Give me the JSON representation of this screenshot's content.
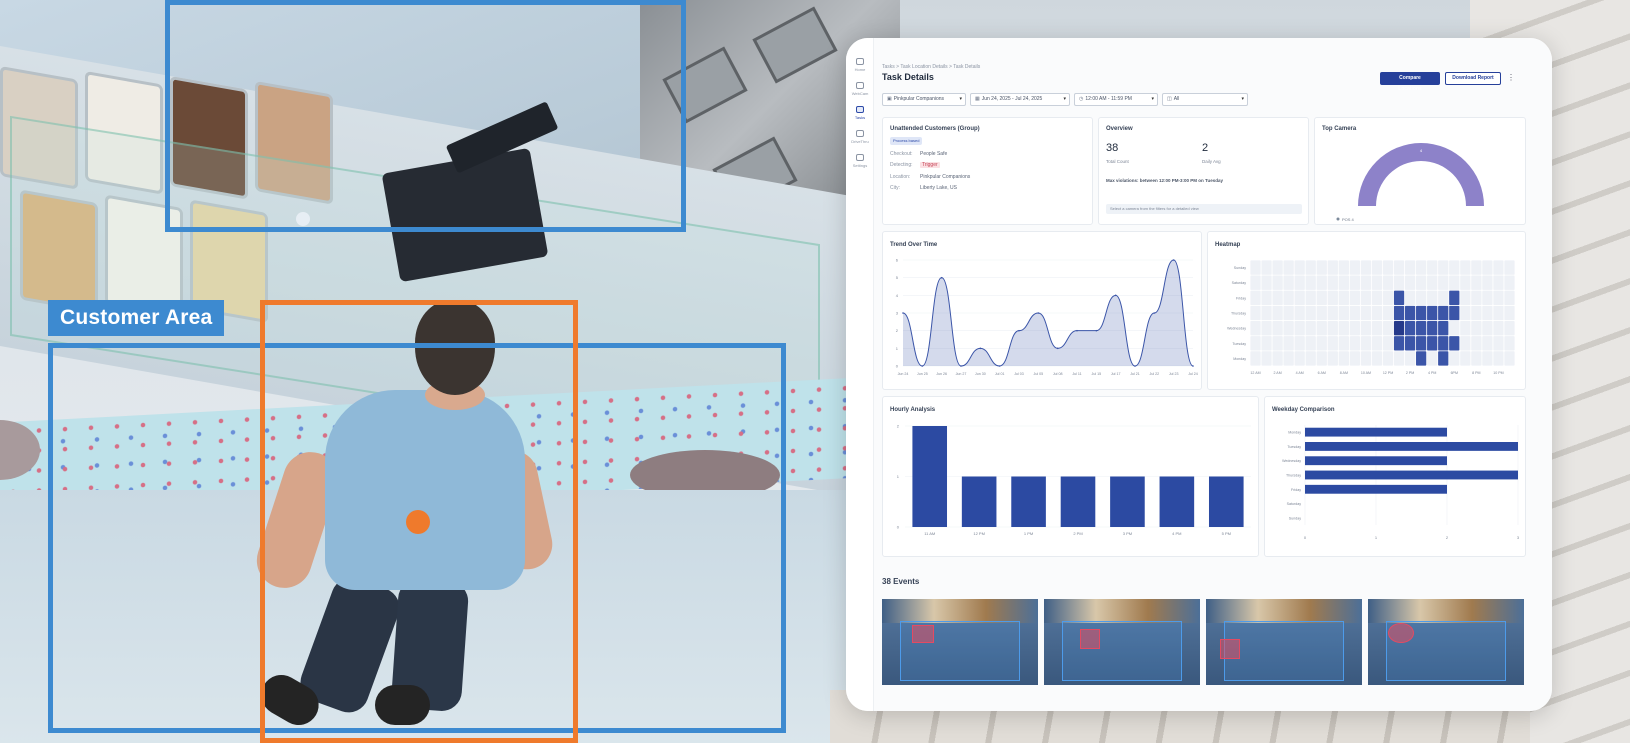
{
  "scene": {
    "area_label": "Customer Area",
    "colors": {
      "zone": "#3d8ad0",
      "person": "#ef7a2c"
    }
  },
  "app": {
    "nav": [
      {
        "label": "Home",
        "icon": "home-icon"
      },
      {
        "label": "WebCam",
        "icon": "camera-icon"
      },
      {
        "label": "Tasks",
        "icon": "tasks-icon"
      },
      {
        "label": "DriveThru",
        "icon": "car-icon"
      },
      {
        "label": "Settings",
        "icon": "gear-icon"
      }
    ],
    "breadcrumb": "Tasks  >  Task Location Details  >  Task Details",
    "title": "Task Details",
    "buttons": {
      "compare": "Compare Locations",
      "download": "Download Report"
    },
    "filters": {
      "location": "Pinkpular Companions",
      "date_range": "Jun 24, 2025 - Jul 24, 2025",
      "time_range": "12:00 AM - 11:59 PM",
      "camera": "All"
    },
    "task_card": {
      "title": "Unattended Customers (Group)",
      "badge": "Process based",
      "rows": [
        {
          "key": "Checkout:",
          "value": "People Safe",
          "alert": false
        },
        {
          "key": "Detecting:",
          "value": "Trigger",
          "alert": true
        },
        {
          "key": "Location:",
          "value": "Pinkpular Companions",
          "alert": false
        },
        {
          "key": "City:",
          "value": "Liberty Lake, US",
          "alert": false
        }
      ]
    },
    "overview": {
      "title": "Overview",
      "total_count": "38",
      "total_label": "Total Count",
      "daily_avg": "2",
      "daily_label": "Daily Avg",
      "max_violations": "Max violations: between 12:00 PM-3:00 PM on Tuesday",
      "hint": "Select a camera from the filters for a detailed view"
    },
    "top_camera": {
      "title": "Top Camera",
      "legend": "POS 4",
      "value": "4"
    },
    "events_title": "38 Events"
  },
  "chart_data": [
    {
      "type": "area",
      "title": "Trend Over Time",
      "categories": [
        "Jun 24",
        "Jun 26",
        "Jun 28",
        "Jun 30",
        "Jul 02",
        "Jul 04",
        "Jul 06",
        "Jul 08",
        "Jul 10",
        "Jul 12",
        "Jul 14",
        "Jul 16",
        "Jul 18",
        "Jul 20",
        "Jul 22",
        "Jul 24"
      ],
      "tick_labels": [
        "Jun 24",
        "Jun 25",
        "Jun 26",
        "Jun 27",
        "Jun 30",
        "Jul 01",
        "Jul 03",
        "Jul 05",
        "Jul 08",
        "Jul 11",
        "Jul 15",
        "Jul 17",
        "Jul 21",
        "Jul 22",
        "Jul 23",
        "Jul 24"
      ],
      "values": [
        3,
        0,
        5,
        0,
        1,
        0,
        2,
        3,
        1,
        2,
        2,
        4,
        0,
        3,
        6,
        0
      ],
      "ylim": [
        0,
        6
      ],
      "yticks": [
        "0",
        "1",
        "2",
        "3",
        "4",
        "5",
        "6"
      ],
      "color": "#3b55a8"
    },
    {
      "type": "heatmap",
      "title": "Heatmap",
      "rows": [
        "Sunday",
        "Saturday",
        "Friday",
        "Thursday",
        "Wednesday",
        "Tuesday",
        "Monday"
      ],
      "columns": [
        "12 AM",
        "2 AM",
        "4 AM",
        "6 AM",
        "8 AM",
        "10 AM",
        "12 PM",
        "2 PM",
        "4 PM",
        "6PM",
        "8 PM",
        "10 PM"
      ],
      "cells": [
        [
          0,
          0,
          0,
          0,
          0,
          0,
          0,
          0,
          0,
          0,
          0,
          0,
          0,
          0,
          0,
          0,
          0,
          0,
          0,
          0,
          0,
          0,
          0,
          0
        ],
        [
          0,
          0,
          0,
          0,
          0,
          0,
          0,
          0,
          0,
          0,
          0,
          0,
          0,
          0,
          0,
          0,
          0,
          0,
          0,
          0,
          0,
          0,
          0,
          0
        ],
        [
          0,
          0,
          0,
          0,
          0,
          0,
          0,
          0,
          0,
          0,
          0,
          0,
          0,
          1,
          0,
          0,
          0,
          0,
          1,
          0,
          0,
          0,
          0,
          0
        ],
        [
          0,
          0,
          0,
          0,
          0,
          0,
          0,
          0,
          0,
          0,
          0,
          0,
          0,
          1,
          1,
          1,
          1,
          1,
          1,
          0,
          0,
          0,
          0,
          0
        ],
        [
          0,
          0,
          0,
          0,
          0,
          0,
          0,
          0,
          0,
          0,
          0,
          0,
          0,
          2,
          1,
          1,
          1,
          1,
          0,
          0,
          0,
          0,
          0,
          0
        ],
        [
          0,
          0,
          0,
          0,
          0,
          0,
          0,
          0,
          0,
          0,
          0,
          0,
          0,
          1,
          1,
          1,
          1,
          1,
          1,
          0,
          0,
          0,
          0,
          0
        ],
        [
          0,
          0,
          0,
          0,
          0,
          0,
          0,
          0,
          0,
          0,
          0,
          0,
          0,
          0,
          0,
          1,
          0,
          1,
          0,
          0,
          0,
          0,
          0,
          0
        ]
      ],
      "color": "#3b55a8"
    },
    {
      "type": "bar",
      "title": "Hourly Analysis",
      "categories": [
        "11 AM",
        "12 PM",
        "1 PM",
        "2 PM",
        "3 PM",
        "4 PM",
        "5 PM"
      ],
      "values": [
        2,
        1,
        1,
        1,
        1,
        1,
        1
      ],
      "ylim": [
        0,
        2
      ],
      "yticks": [
        "0",
        "1",
        "2"
      ],
      "color": "#2c4aa2"
    },
    {
      "type": "bar",
      "orientation": "horizontal",
      "title": "Weekday Comparison",
      "categories": [
        "Monday",
        "Tuesday",
        "Wednesday",
        "Thursday",
        "Friday",
        "Saturday",
        "Sunday"
      ],
      "values": [
        2,
        3,
        2,
        3,
        2,
        0,
        0
      ],
      "xlim": [
        0,
        3
      ],
      "xticks": [
        "0",
        "1",
        "2",
        "3"
      ],
      "color": "#2c4aa2"
    }
  ]
}
